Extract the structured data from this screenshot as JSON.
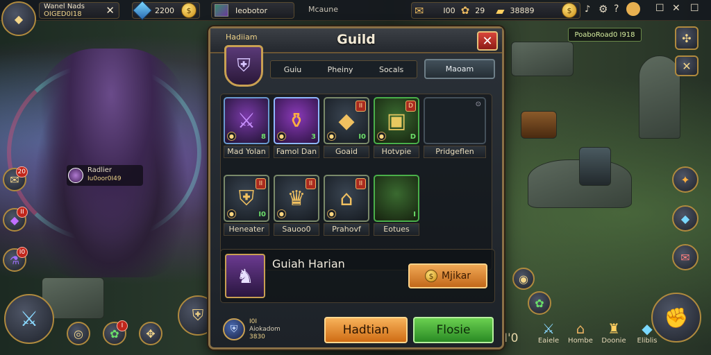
{
  "topbar": {
    "player_name": "Wanel Nads",
    "player_id": "OIGED0I18",
    "gems": "2200",
    "name_box": "Ieobotor",
    "section": "Mcaune",
    "res1": "I00",
    "res2": "29",
    "gold": "38889"
  },
  "hero": {
    "tag_name": "Radlier",
    "tag_id": "Iu0oor0I49"
  },
  "left_badges": [
    "20",
    "II",
    "I0"
  ],
  "world": {
    "info_label": "PoaboRoad0 I918"
  },
  "modal": {
    "title": "Guild",
    "guild_name": "Hadiiam",
    "tabs": [
      "Guiu",
      "Pheiny",
      "Socals"
    ],
    "wide_button": "Maoam",
    "slots": [
      {
        "label": "Mad Yolan",
        "icon": "⚔",
        "badge": "",
        "style": "purple",
        "count": "8"
      },
      {
        "label": "Famol Dan",
        "icon": "⚱",
        "badge": "",
        "style": "orange",
        "count": "3"
      },
      {
        "label": "Goaid",
        "icon": "◆",
        "badge": "II",
        "style": "gray",
        "count": "I0"
      },
      {
        "label": "Hotvpie",
        "icon": "▣",
        "badge": "D",
        "style": "green",
        "count": "D"
      },
      {
        "label": "Pridgeflen",
        "icon": "",
        "badge": "",
        "style": "dark",
        "count": ""
      },
      {
        "label": "Heneater",
        "icon": "⛨",
        "badge": "II",
        "style": "gray",
        "count": "I0"
      },
      {
        "label": "Sauoo0",
        "icon": "♛",
        "badge": "II",
        "style": "gray",
        "count": ""
      },
      {
        "label": "Prahovf",
        "icon": "⌂",
        "badge": "II",
        "style": "gray",
        "count": ""
      },
      {
        "label": "Eotues",
        "icon": "",
        "badge": "",
        "style": "green",
        "count": "I"
      }
    ],
    "info_title": "Guiah Harian",
    "mk_label": "Mjikar",
    "footer_line1": "I0I",
    "footer_line2": "Aiokadom",
    "footer_line3": "3830",
    "primary_button": "Hadtian",
    "secondary_button": "Flosie"
  },
  "bottom_labels": [
    "Eaiele",
    "Hombe",
    "Doonie",
    "Eliblis"
  ],
  "bottom_left_badge": "I",
  "bottom_center_text": "I'0"
}
